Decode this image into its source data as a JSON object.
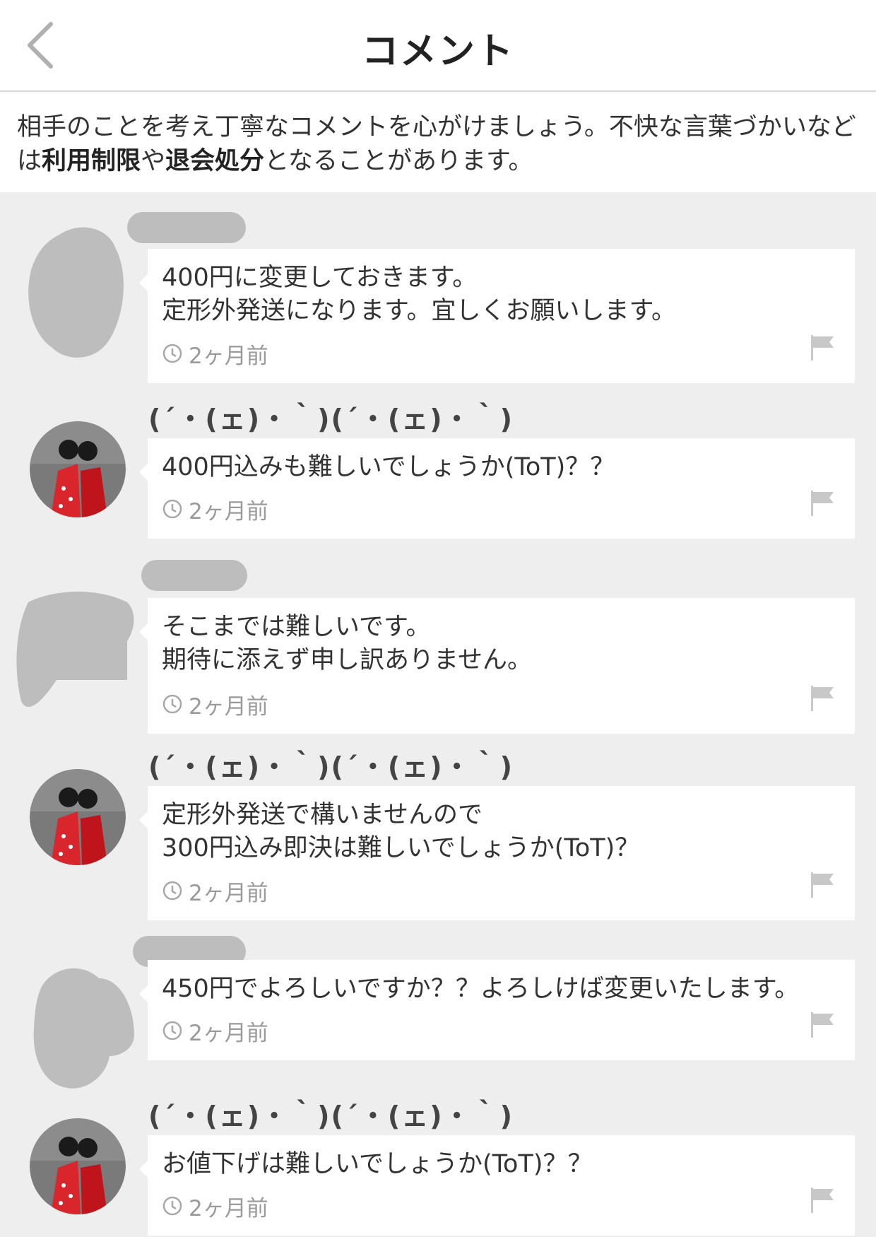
{
  "header": {
    "title": "コメント"
  },
  "notice": {
    "text_1": "相手のことを考え丁寧なコメントを心がけましょう。不快な言葉づかいなどは",
    "bold_1": "利用制限",
    "text_2": "や",
    "bold_2": "退会処分",
    "text_3": "となることがあります。"
  },
  "comments": [
    {
      "author": "",
      "body": "400円に変更しておきます。\n定形外発送になります。宜しくお願いします。",
      "time": "2ヶ月前"
    },
    {
      "author": "(´・(ェ)・｀)(´・(ェ)・｀)",
      "body": "400円込みも難しいでしょうか(ToT)？？",
      "time": "2ヶ月前"
    },
    {
      "author": "",
      "body": "そこまでは難しいです。\n期待に添えず申し訳ありません。",
      "time": "2ヶ月前"
    },
    {
      "author": "(´・(ェ)・｀)(´・(ェ)・｀)",
      "body": "定形外発送で構いませんので\n300円込み即決は難しいでしょうか(ToT)？",
      "time": "2ヶ月前"
    },
    {
      "author": "",
      "body": "450円でよろしいですか？？よろしけば変更いたします。",
      "time": "2ヶ月前"
    },
    {
      "author": "(´・(ェ)・｀)(´・(ェ)・｀)",
      "body": "お値下げは難しいでしょうか(ToT)？？",
      "time": "2ヶ月前"
    }
  ],
  "colors": {
    "background": "#eeeeee",
    "bubble": "#ffffff",
    "muted": "#9a9a9a"
  },
  "icons": {
    "back": "chevron-left-icon",
    "clock": "clock-icon",
    "flag": "flag-icon"
  }
}
